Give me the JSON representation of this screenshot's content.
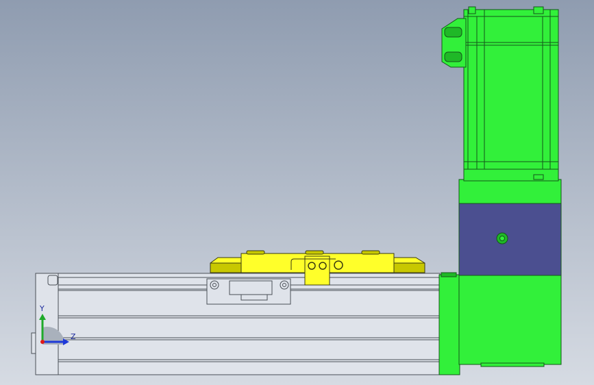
{
  "viewport": {
    "background_top": "#8f9cb0",
    "background_bottom": "#d6dbe3"
  },
  "colors": {
    "rail_face": "#dfe3ea",
    "rail_edge": "#4a4f56",
    "carriage_yellow": "#ffff2a",
    "carriage_shade": "#c8c800",
    "motor_green": "#32f03a",
    "motor_shade": "#1fb827",
    "housing_blue": "#4b4f90",
    "axis_y": "#1faa2a",
    "axis_z": "#1e39d8",
    "axis_origin": "#e01818"
  },
  "triad": {
    "y_label": "Y",
    "z_label": "Z"
  }
}
